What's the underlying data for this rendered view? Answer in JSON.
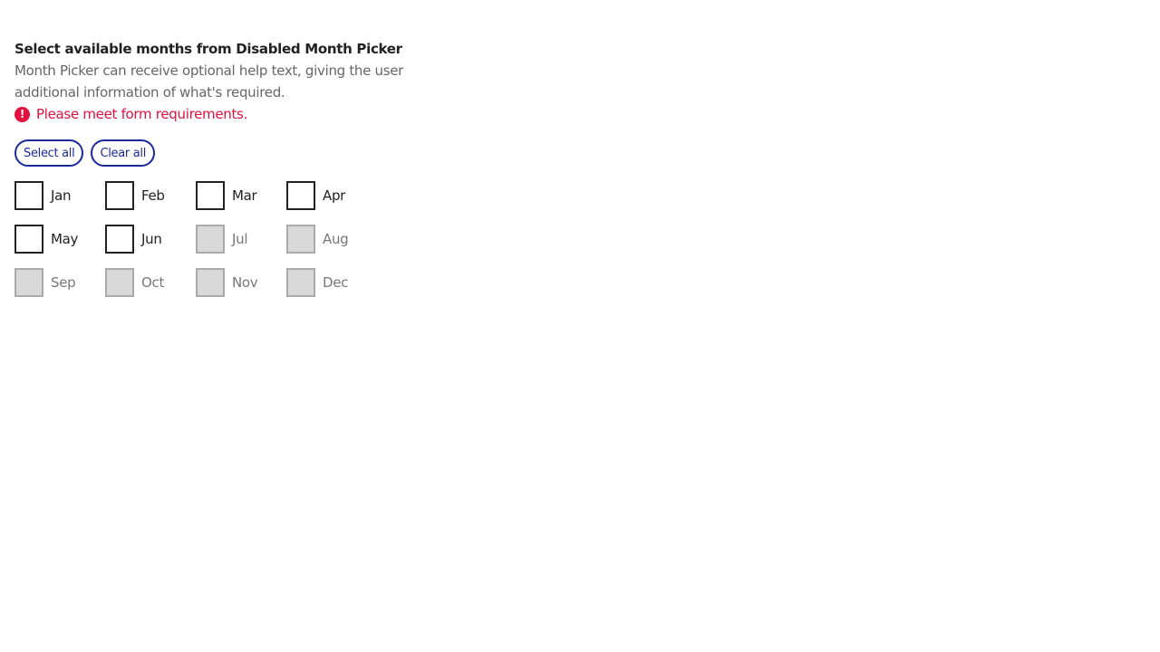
{
  "title": "Select available months from Disabled Month Picker",
  "help": "Month Picker can receive optional help text, giving the user additional information of what's required.",
  "error": "Please meet form requirements.",
  "error_icon": "!",
  "select_all": "Select all",
  "clear_all": "Clear all",
  "months": [
    {
      "label": "Jan",
      "disabled": false,
      "checked": false
    },
    {
      "label": "Feb",
      "disabled": false,
      "checked": false
    },
    {
      "label": "Mar",
      "disabled": false,
      "checked": false
    },
    {
      "label": "Apr",
      "disabled": false,
      "checked": false
    },
    {
      "label": "May",
      "disabled": false,
      "checked": false
    },
    {
      "label": "Jun",
      "disabled": false,
      "checked": false
    },
    {
      "label": "Jul",
      "disabled": true,
      "checked": false
    },
    {
      "label": "Aug",
      "disabled": true,
      "checked": false
    },
    {
      "label": "Sep",
      "disabled": true,
      "checked": false
    },
    {
      "label": "Oct",
      "disabled": true,
      "checked": false
    },
    {
      "label": "Nov",
      "disabled": true,
      "checked": false
    },
    {
      "label": "Dec",
      "disabled": true,
      "checked": false
    }
  ]
}
